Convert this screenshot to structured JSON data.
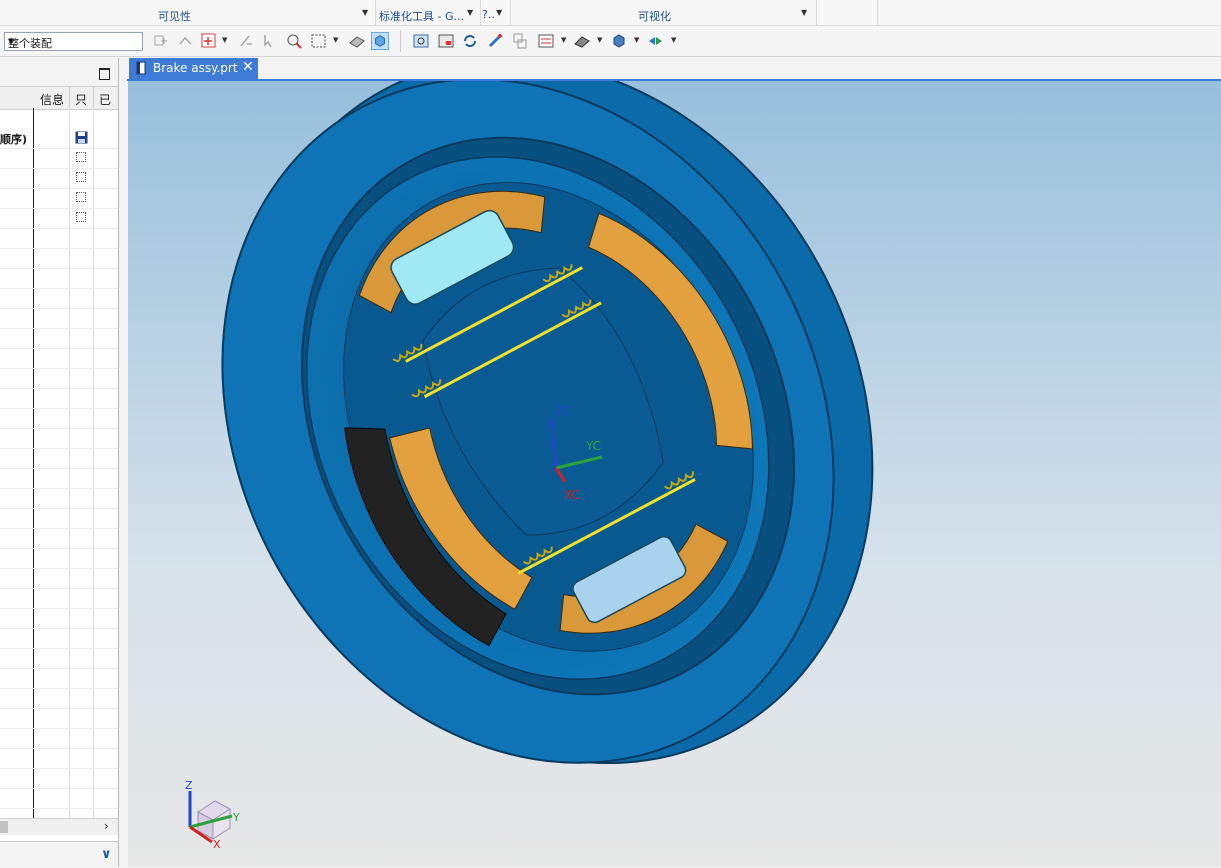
{
  "ribbon": {
    "groups": [
      {
        "label": "可见性"
      },
      {
        "label": "标准化工具 - G..."
      },
      {
        "label": "?.."
      },
      {
        "label": "可视化"
      }
    ]
  },
  "toolbar": {
    "assembly_filter": "整个装配"
  },
  "navigator": {
    "columns": {
      "info": "信息",
      "readonly": "只",
      "modified": "已"
    },
    "row_fragment": "顺序)"
  },
  "tab": {
    "label": "Brake assy.prt",
    "close": "✕"
  },
  "viewport": {
    "axes": {
      "z": "ZC",
      "y": "YC",
      "x": "XC"
    },
    "triad": {
      "z": "Z",
      "y": "Y",
      "x": "X"
    },
    "colors": {
      "drum": "#0e74b6",
      "shoe": "#e2a13e",
      "spring": "#f0e12a",
      "cylinder": "#9fe8f4",
      "bg_top": "#97bfdc",
      "bg_bottom": "#e7e7e7"
    }
  }
}
